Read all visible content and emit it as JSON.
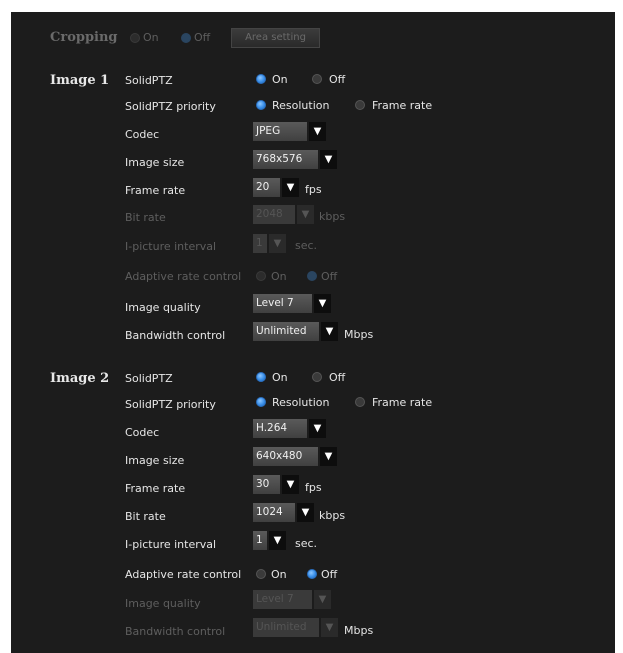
{
  "cropping": {
    "title": "Cropping",
    "on": "On",
    "off": "Off",
    "area_button": "Area setting"
  },
  "image1": {
    "title": "Image 1",
    "solidptz": {
      "label": "SolidPTZ",
      "on": "On",
      "off": "Off",
      "value": "On"
    },
    "priority": {
      "label": "SolidPTZ priority",
      "opt1": "Resolution",
      "opt2": "Frame rate",
      "value": "Resolution"
    },
    "codec": {
      "label": "Codec",
      "value": "JPEG"
    },
    "image_size": {
      "label": "Image size",
      "value": "768x576"
    },
    "frame_rate": {
      "label": "Frame rate",
      "value": "20",
      "unit": "fps"
    },
    "bit_rate": {
      "label": "Bit rate",
      "value": "2048",
      "unit": "kbps"
    },
    "ipicture": {
      "label": "I-picture interval",
      "value": "1",
      "unit": "sec."
    },
    "adaptive": {
      "label": "Adaptive rate control",
      "on": "On",
      "off": "Off"
    },
    "quality": {
      "label": "Image quality",
      "value": "Level 7"
    },
    "bandwidth": {
      "label": "Bandwidth control",
      "value": "Unlimited",
      "unit": "Mbps"
    }
  },
  "image2": {
    "title": "Image 2",
    "solidptz": {
      "label": "SolidPTZ",
      "on": "On",
      "off": "Off",
      "value": "On"
    },
    "priority": {
      "label": "SolidPTZ priority",
      "opt1": "Resolution",
      "opt2": "Frame rate",
      "value": "Resolution"
    },
    "codec": {
      "label": "Codec",
      "value": "H.264"
    },
    "image_size": {
      "label": "Image size",
      "value": "640x480"
    },
    "frame_rate": {
      "label": "Frame rate",
      "value": "30",
      "unit": "fps"
    },
    "bit_rate": {
      "label": "Bit rate",
      "value": "1024",
      "unit": "kbps"
    },
    "ipicture": {
      "label": "I-picture interval",
      "value": "1",
      "unit": "sec."
    },
    "adaptive": {
      "label": "Adaptive rate control",
      "on": "On",
      "off": "Off",
      "value": "Off"
    },
    "quality": {
      "label": "Image quality",
      "value": "Level 7"
    },
    "bandwidth": {
      "label": "Bandwidth control",
      "value": "Unlimited",
      "unit": "Mbps"
    }
  },
  "icons": {
    "dropdown": "chevron-down-icon",
    "radio": "radio-icon"
  },
  "colors": {
    "background": "#1c1c1c",
    "accent": "#3a8fe8",
    "text": "#e6e6e6",
    "disabled": "#5e5e5e"
  }
}
